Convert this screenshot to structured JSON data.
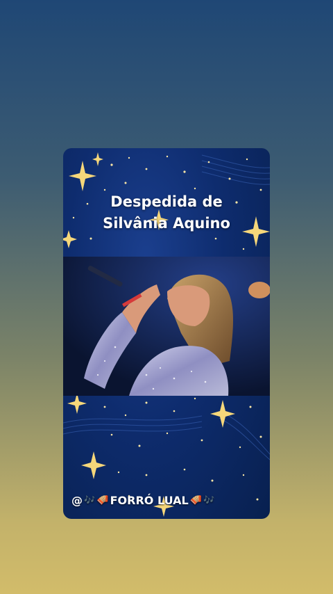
{
  "card": {
    "title_line1": "Despedida de",
    "title_line2": "Silvânia Aquino"
  },
  "caption": {
    "at": "@",
    "notes_left": "🎶",
    "accordion_left": "🪗",
    "text": "FORRÓ LUAL",
    "accordion_right": "🪗",
    "notes_right": "🎶"
  },
  "photo": {
    "icon": "singer-photo"
  },
  "colors": {
    "background_top": "#1f4775",
    "background_bottom": "#d2bc6a",
    "card_blue": "#0e2c6e",
    "star_gold": "#f6d77a",
    "dress_silver": "#b9bad8"
  }
}
